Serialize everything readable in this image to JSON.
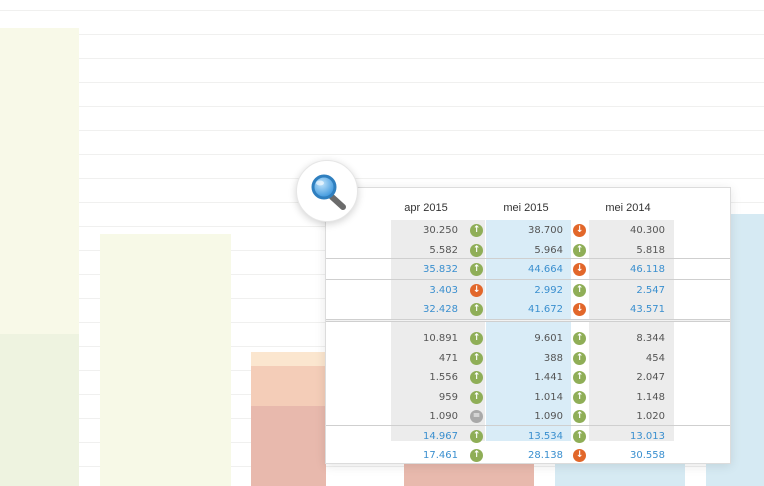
{
  "colors": {
    "up": "#8fae57",
    "down": "#e2672a",
    "equal": "#a9a9a9",
    "text_dark": "#555555",
    "text_blue": "#3a8fcf",
    "shade_gray": "#ececec",
    "shade_blue": "#d9ecf7"
  },
  "magnifier": {
    "icon": "magnifier-icon"
  },
  "columns": [
    {
      "label": "apr 2015"
    },
    {
      "label": "mei 2015"
    },
    {
      "label": "mei 2014"
    }
  ],
  "rows": [
    {
      "kind": "dark",
      "v1": "30.250",
      "t1": "up",
      "v2": "38.700",
      "t2": "down",
      "v3": "40.300"
    },
    {
      "kind": "dark",
      "v1": "5.582",
      "t1": "up",
      "v2": "5.964",
      "t2": "up",
      "v3": "5.818"
    },
    {
      "kind": "blue",
      "v1": "35.832",
      "t1": "up",
      "v2": "44.664",
      "t2": "down",
      "v3": "46.118"
    },
    {
      "kind": "blue",
      "v1": "3.403",
      "t1": "down",
      "v2": "2.992",
      "t2": "up",
      "v3": "2.547"
    },
    {
      "kind": "blue",
      "v1": "32.428",
      "t1": "up",
      "v2": "41.672",
      "t2": "down",
      "v3": "43.571"
    },
    {
      "kind": "dark",
      "v1": "10.891",
      "t1": "up",
      "v2": "9.601",
      "t2": "up",
      "v3": "8.344"
    },
    {
      "kind": "dark",
      "v1": "471",
      "t1": "up",
      "v2": "388",
      "t2": "up",
      "v3": "454"
    },
    {
      "kind": "dark",
      "v1": "1.556",
      "t1": "up",
      "v2": "1.441",
      "t2": "up",
      "v3": "2.047"
    },
    {
      "kind": "dark",
      "v1": "959",
      "t1": "up",
      "v2": "1.014",
      "t2": "up",
      "v3": "1.148"
    },
    {
      "kind": "dark",
      "v1": "1.090",
      "t1": "equal",
      "v2": "1.090",
      "t2": "up",
      "v3": "1.020"
    },
    {
      "kind": "blue",
      "v1": "14.967",
      "t1": "up",
      "v2": "13.534",
      "t2": "up",
      "v3": "13.013"
    },
    {
      "kind": "blue",
      "v1": "17.461",
      "t1": "up",
      "v2": "28.138",
      "t2": "down",
      "v3": "30.558"
    }
  ]
}
